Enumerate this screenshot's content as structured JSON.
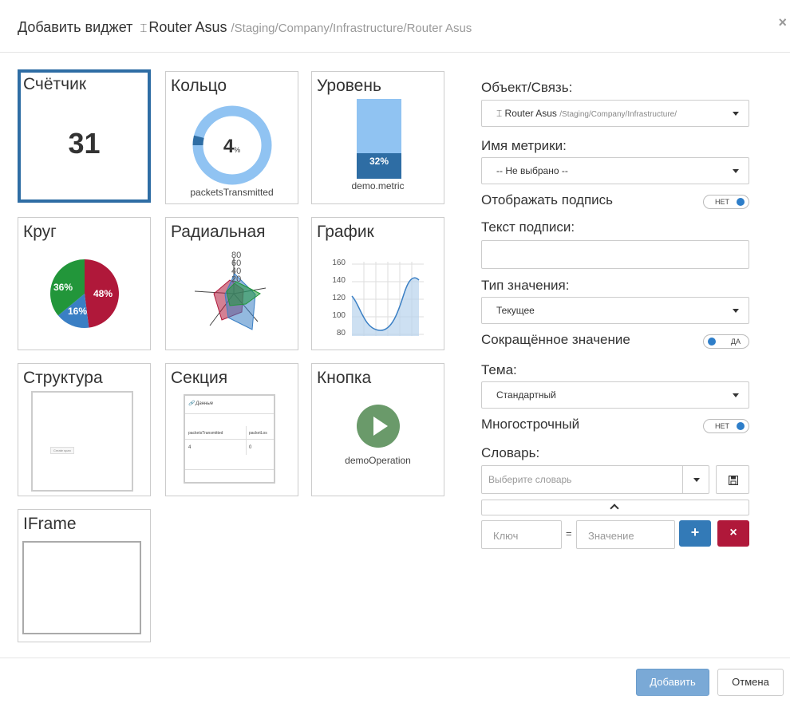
{
  "header": {
    "title": "Добавить виджет",
    "object_icon": "router-icon",
    "object_name": "Router Asus",
    "object_path": "/Staging/Company/Infrastructure/Router Asus",
    "close": "×"
  },
  "tiles": {
    "counter": {
      "label": "Счётчик",
      "value": "31"
    },
    "ring": {
      "label": "Кольцо",
      "value": "4",
      "unit": "%",
      "percent": 4,
      "caption": "packetsTransmitted"
    },
    "level": {
      "label": "Уровень",
      "percent_text": "32%",
      "percent": 32,
      "caption": "demo.metric"
    },
    "pie": {
      "label": "Круг",
      "slices": [
        {
          "text": "48%",
          "value": 48,
          "color": "#b0183a"
        },
        {
          "text": "16%",
          "value": 16,
          "color": "#3a7fc4"
        },
        {
          "text": "36%",
          "value": 36,
          "color": "#22963a"
        }
      ]
    },
    "radial": {
      "label": "Радиальная",
      "ticks": [
        "80",
        "60",
        "40",
        "20"
      ]
    },
    "graph": {
      "label": "График",
      "ticks": [
        "160",
        "140",
        "120",
        "100",
        "80"
      ]
    },
    "structure": {
      "label": "Структура",
      "inner_text": "Create span"
    },
    "section": {
      "label": "Секция",
      "header": "Данные",
      "col1": "packetsTransmitted",
      "col2": "packetLos",
      "val1": "4",
      "val2": "0"
    },
    "button": {
      "label": "Кнопка",
      "caption": "demoOperation",
      "color": "#6a9a6a"
    },
    "iframe": {
      "label": "IFrame"
    }
  },
  "form": {
    "object_label": "Объект/Связь:",
    "object_value_name": "Router Asus",
    "object_value_path": "/Staging/Company/Infrastructure/",
    "metric_label": "Имя метрики:",
    "metric_value": "-- Не выбрано --",
    "show_caption_label": "Отображать подпись",
    "show_caption_toggle": "НЕТ",
    "caption_text_label": "Текст подписи:",
    "caption_text_value": "",
    "value_type_label": "Тип значения:",
    "value_type_value": "Текущее",
    "short_value_label": "Сокращённое значение",
    "short_value_toggle": "ДА",
    "theme_label": "Тема:",
    "theme_value": "Стандартный",
    "multiline_label": "Многострочный",
    "multiline_toggle": "НЕТ",
    "dict_label": "Словарь:",
    "dict_placeholder": "Выберите словарь",
    "key_placeholder": "Ключ",
    "equals": "=",
    "value_placeholder": "Значение",
    "add_symbol": "+",
    "remove_symbol": "×"
  },
  "footer": {
    "add_label": "Добавить",
    "cancel_label": "Отмена"
  },
  "colors": {
    "primary": "#337ab7",
    "danger": "#b0183a",
    "accent": "#2e6da4"
  }
}
